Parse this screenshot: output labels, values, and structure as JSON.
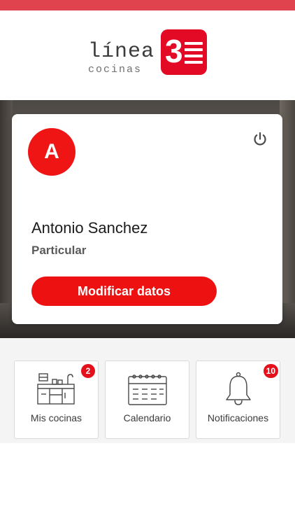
{
  "brand": {
    "wordmark": "línea",
    "subtitle": "cocinas",
    "badge_digit": "3"
  },
  "profile": {
    "avatar_initial": "A",
    "name": "Antonio Sanchez",
    "type": "Particular",
    "modify_label": "Modificar datos",
    "power_icon": "power-icon"
  },
  "tiles": [
    {
      "label": "Mis cocinas",
      "icon": "kitchen-icon",
      "badge": "2"
    },
    {
      "label": "Calendario",
      "icon": "calendar-icon",
      "badge": ""
    },
    {
      "label": "Notificaciones",
      "icon": "bell-icon",
      "badge": "10"
    }
  ],
  "colors": {
    "accent": "#ee1111",
    "top_bar": "#e0424e",
    "logo_red": "#e30a26"
  }
}
